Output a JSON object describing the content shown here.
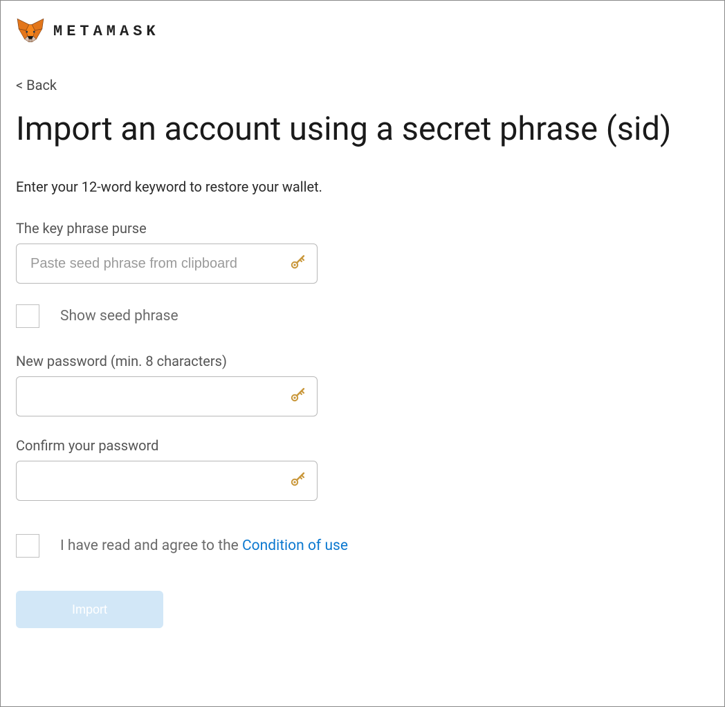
{
  "header": {
    "brand": "METAMASK"
  },
  "back": {
    "label": "< Back"
  },
  "title": "Import an account using a secret phrase (sid)",
  "subtitle": "Enter your 12-word keyword to restore your wallet.",
  "seedPhrase": {
    "label": "The key phrase purse",
    "placeholder": "Paste seed phrase from clipboard",
    "value": ""
  },
  "showSeed": {
    "label": "Show seed phrase",
    "checked": false
  },
  "newPassword": {
    "label": "New password (min. 8 characters)",
    "value": ""
  },
  "confirmPassword": {
    "label": "Confirm your password",
    "value": ""
  },
  "terms": {
    "prefix": "I have read and agree to the ",
    "linkText": "Condition of use",
    "checked": false
  },
  "importButton": {
    "label": "Import"
  }
}
